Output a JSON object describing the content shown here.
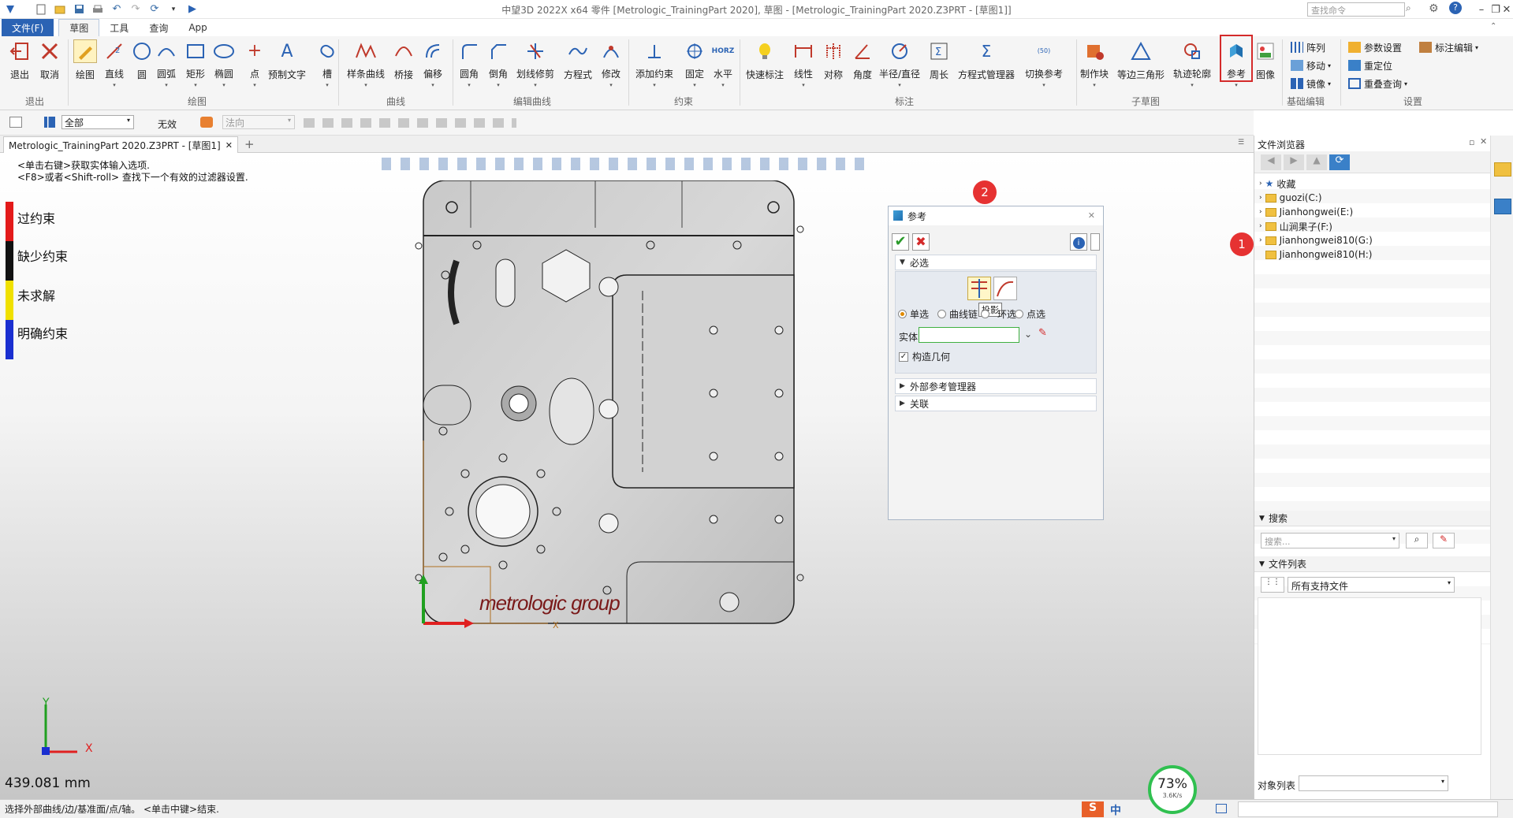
{
  "window": {
    "title": "中望3D 2022X x64      零件 [Metrologic_TrainingPart 2020], 草图 - [Metrologic_TrainingPart 2020.Z3PRT - [草图1]]",
    "search_placeholder": "查找命令"
  },
  "menu": [
    "文件(F)",
    "草图",
    "工具",
    "查询",
    "App"
  ],
  "ribbon": {
    "buttons": [
      "退出",
      "取消",
      "绘图",
      "直线",
      "圆",
      "圆弧",
      "矩形",
      "椭圆",
      "点",
      "预制文字",
      "槽",
      "样条曲线",
      "桥接",
      "偏移",
      "圆角",
      "倒角",
      "划线修剪",
      "方程式",
      "修改",
      "添加约束",
      "固定",
      "水平",
      "快速标注",
      "线性",
      "对称",
      "角度",
      "半径/直径",
      "周长",
      "方程式管理器",
      "切换参考",
      "制作块",
      "等边三角形",
      "轨迹轮廓",
      "参考",
      "图像"
    ],
    "small": [
      "阵列",
      "移动",
      "镜像",
      "参数设置",
      "重定位",
      "重叠查询",
      "标注编辑"
    ],
    "groups": [
      "退出",
      "绘图",
      "曲线",
      "编辑曲线",
      "约束",
      "标注",
      "子草图",
      "基础编辑",
      "设置"
    ]
  },
  "filter": {
    "scope": "全部",
    "state": "无效",
    "direction": "法向"
  },
  "doc_tab": "Metrologic_TrainingPart 2020.Z3PRT - [草图1]",
  "hints": [
    "<单击右键>获取实体输入选项.",
    "<F8>或者<Shift-roll> 查找下一个有效的过滤器设置."
  ],
  "legend": [
    {
      "label": "过约束",
      "color": "#e31a1a"
    },
    {
      "label": "缺少约束",
      "color": "#111111"
    },
    {
      "label": "未求解",
      "color": "#f0e000"
    },
    {
      "label": "明确约束",
      "color": "#1a2fd0"
    }
  ],
  "viewport": {
    "logo": "metrologic group",
    "distance": "439.081 mm",
    "axis_x": "X",
    "axis_y": "Y"
  },
  "dialog": {
    "title": "参考",
    "required": "必选",
    "radios": [
      "单选",
      "曲线链",
      "环选",
      "点选"
    ],
    "tooltip": "投影",
    "entity_label": "实体",
    "construct_label": "构造几何",
    "sections": [
      "外部参考管理器",
      "关联"
    ]
  },
  "file_browser": {
    "title": "文件浏览器",
    "tree": [
      "收藏",
      "guozi(C:)",
      "Jianhongwei(E:)",
      "山涧果子(F:)",
      "Jianhongwei810(G:)",
      "Jianhongwei810(H:)"
    ],
    "search_header": "搜索",
    "search_placeholder": "搜索...",
    "file_list_header": "文件列表",
    "file_filter": "所有支持文件",
    "object_list": "对象列表"
  },
  "status": {
    "text": "选择外部曲线/边/基准面/点/轴。 <单击中键>结束.",
    "ime": "中",
    "progress": "73%",
    "speed": "3.6K/s"
  },
  "badges": [
    "1",
    "2"
  ]
}
